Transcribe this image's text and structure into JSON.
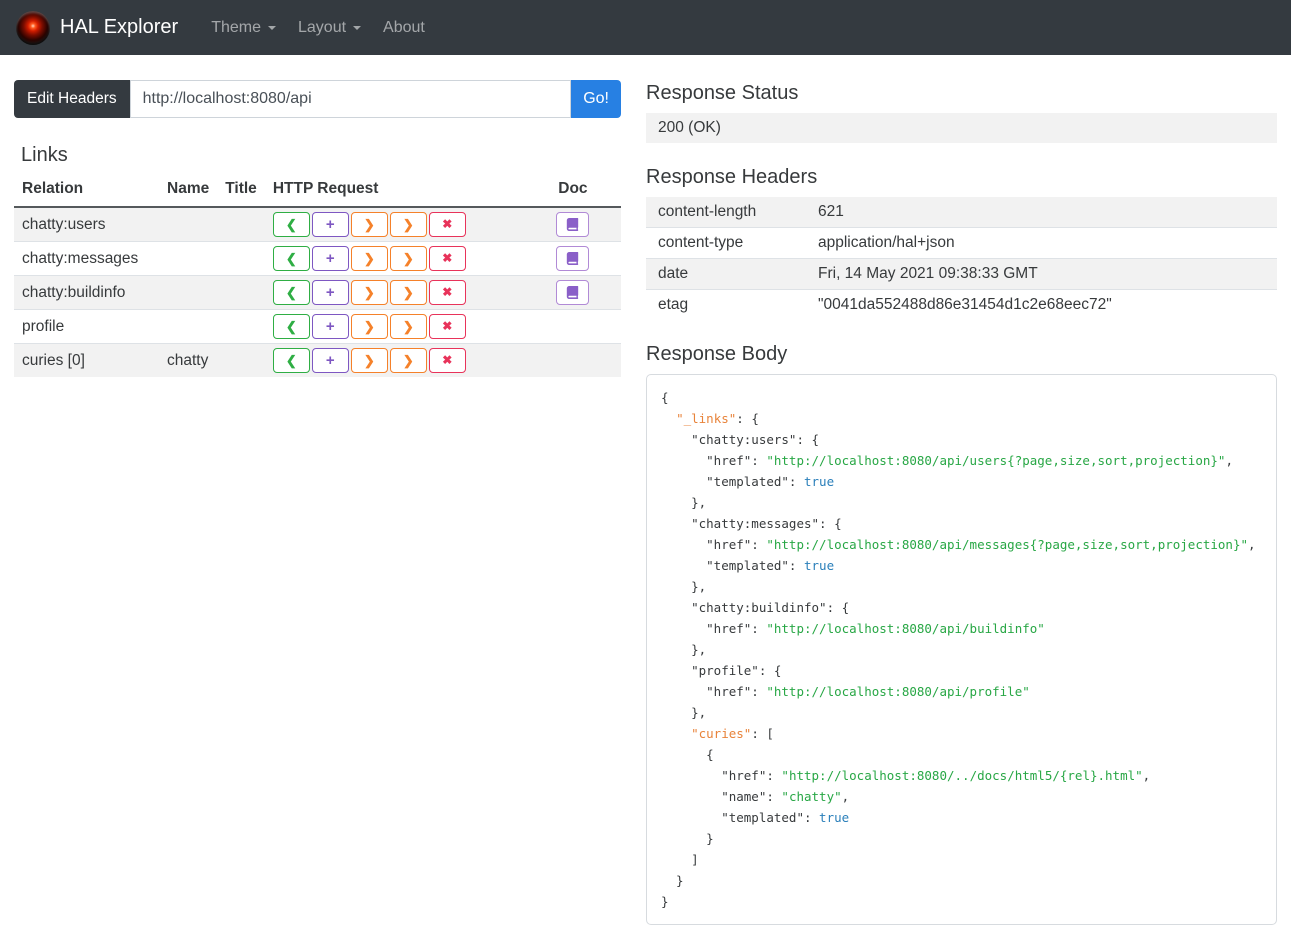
{
  "navbar": {
    "brand": "HAL Explorer",
    "items": [
      {
        "label": "Theme",
        "has_caret": true
      },
      {
        "label": "Layout",
        "has_caret": true
      },
      {
        "label": "About",
        "has_caret": false
      }
    ]
  },
  "address_bar": {
    "edit_headers_label": "Edit Headers",
    "url_value": "http://localhost:8080/api",
    "go_label": "Go!"
  },
  "links": {
    "title": "Links",
    "columns": [
      "Relation",
      "Name",
      "Title",
      "HTTP Request",
      "Doc"
    ],
    "request_buttons": [
      {
        "name": "get-request-button",
        "glyph": "❮",
        "style": "get"
      },
      {
        "name": "post-request-button",
        "glyph": "+",
        "style": "post"
      },
      {
        "name": "put-request-button",
        "glyph": "❯",
        "style": "put"
      },
      {
        "name": "patch-request-button",
        "glyph": "❯",
        "style": "patch"
      },
      {
        "name": "delete-request-button",
        "glyph": "✖",
        "style": "delete"
      }
    ],
    "rows": [
      {
        "relation": "chatty:users",
        "name": "",
        "title": "",
        "doc": true
      },
      {
        "relation": "chatty:messages",
        "name": "",
        "title": "",
        "doc": true
      },
      {
        "relation": "chatty:buildinfo",
        "name": "",
        "title": "",
        "doc": true
      },
      {
        "relation": "profile",
        "name": "",
        "title": "",
        "doc": false
      },
      {
        "relation": "curies [0]",
        "name": "chatty",
        "title": "",
        "doc": false
      }
    ]
  },
  "response_status": {
    "title": "Response Status",
    "value": "200 (OK)"
  },
  "response_headers": {
    "title": "Response Headers",
    "rows": [
      {
        "name": "content-length",
        "value": "621"
      },
      {
        "name": "content-type",
        "value": "application/hal+json"
      },
      {
        "name": "date",
        "value": "Fri, 14 May 2021 09:38:33 GMT"
      },
      {
        "name": "etag",
        "value": "\"0041da552488d86e31454d1c2e68eec72\""
      }
    ]
  },
  "response_body": {
    "title": "Response Body",
    "lines": [
      [
        {
          "c": "pl",
          "t": "{"
        }
      ],
      [
        {
          "c": "pl",
          "t": "  "
        },
        {
          "c": "ko",
          "t": "\"_links\""
        },
        {
          "c": "pl",
          "t": ": {"
        }
      ],
      [
        {
          "c": "pl",
          "t": "    \"chatty:users\": {"
        }
      ],
      [
        {
          "c": "pl",
          "t": "      \"href\": "
        },
        {
          "c": "st",
          "t": "\"http://localhost:8080/api/users{?page,size,sort,projection}\""
        },
        {
          "c": "pl",
          "t": ","
        }
      ],
      [
        {
          "c": "pl",
          "t": "      \"templated\": "
        },
        {
          "c": "bo",
          "t": "true"
        }
      ],
      [
        {
          "c": "pl",
          "t": "    },"
        }
      ],
      [
        {
          "c": "pl",
          "t": "    \"chatty:messages\": {"
        }
      ],
      [
        {
          "c": "pl",
          "t": "      \"href\": "
        },
        {
          "c": "st",
          "t": "\"http://localhost:8080/api/messages{?page,size,sort,projection}\""
        },
        {
          "c": "pl",
          "t": ","
        }
      ],
      [
        {
          "c": "pl",
          "t": "      \"templated\": "
        },
        {
          "c": "bo",
          "t": "true"
        }
      ],
      [
        {
          "c": "pl",
          "t": "    },"
        }
      ],
      [
        {
          "c": "pl",
          "t": "    \"chatty:buildinfo\": {"
        }
      ],
      [
        {
          "c": "pl",
          "t": "      \"href\": "
        },
        {
          "c": "st",
          "t": "\"http://localhost:8080/api/buildinfo\""
        }
      ],
      [
        {
          "c": "pl",
          "t": "    },"
        }
      ],
      [
        {
          "c": "pl",
          "t": "    \"profile\": {"
        }
      ],
      [
        {
          "c": "pl",
          "t": "      \"href\": "
        },
        {
          "c": "st",
          "t": "\"http://localhost:8080/api/profile\""
        }
      ],
      [
        {
          "c": "pl",
          "t": "    },"
        }
      ],
      [
        {
          "c": "pl",
          "t": "    "
        },
        {
          "c": "ko",
          "t": "\"curies\""
        },
        {
          "c": "pl",
          "t": ": ["
        }
      ],
      [
        {
          "c": "pl",
          "t": "      {"
        }
      ],
      [
        {
          "c": "pl",
          "t": "        \"href\": "
        },
        {
          "c": "st",
          "t": "\"http://localhost:8080/../docs/html5/{rel}.html\""
        },
        {
          "c": "pl",
          "t": ","
        }
      ],
      [
        {
          "c": "pl",
          "t": "        \"name\": "
        },
        {
          "c": "st",
          "t": "\"chatty\""
        },
        {
          "c": "pl",
          "t": ","
        }
      ],
      [
        {
          "c": "pl",
          "t": "        \"templated\": "
        },
        {
          "c": "bo",
          "t": "true"
        }
      ],
      [
        {
          "c": "pl",
          "t": "      }"
        }
      ],
      [
        {
          "c": "pl",
          "t": "    ]"
        }
      ],
      [
        {
          "c": "pl",
          "t": "  }"
        }
      ],
      [
        {
          "c": "pl",
          "t": "}"
        }
      ]
    ]
  },
  "colors": {
    "navbar_bg": "#343a40",
    "primary_button": "#2780e3",
    "get_button": "#2fae44",
    "post_button": "#7e57c2",
    "put_patch_button": "#f5812a",
    "delete_button": "#e8335a",
    "doc_button": "#8a5fc8",
    "row_stripe": "#f2f2f2",
    "json_key_highlight": "#e8833a",
    "json_string": "#28a745",
    "json_boolean": "#2a7fba",
    "hal_eye_red": "#d21d00"
  }
}
